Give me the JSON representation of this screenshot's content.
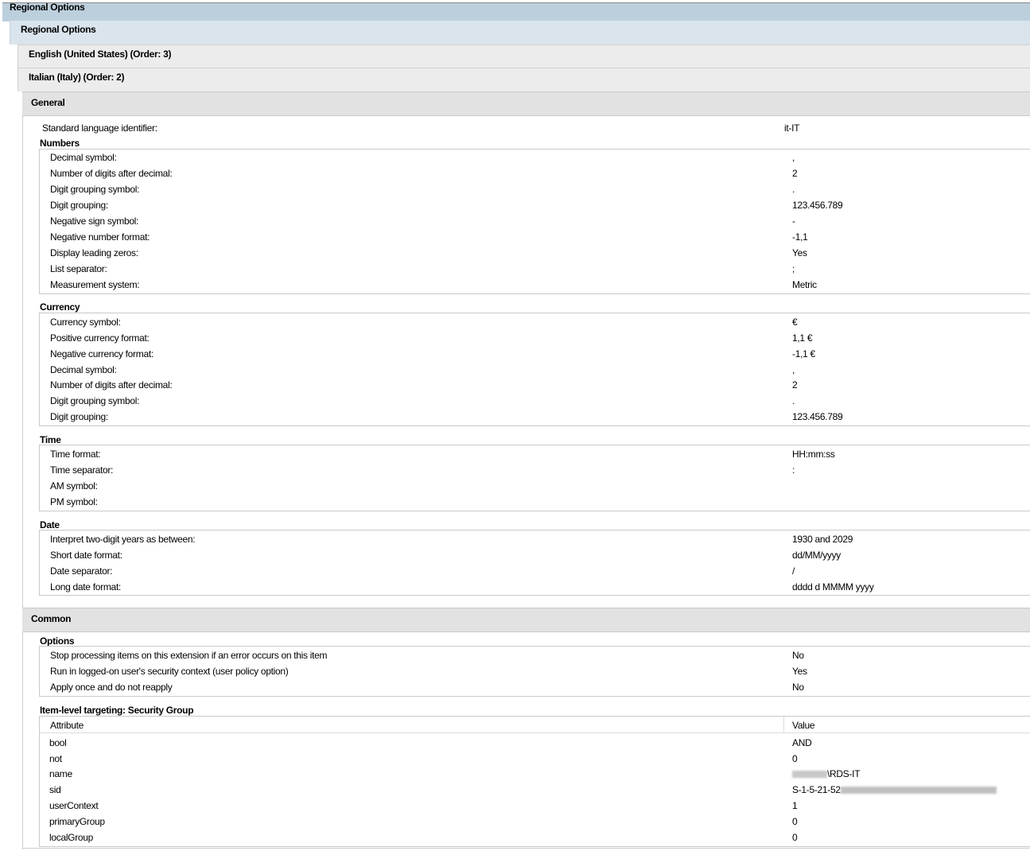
{
  "headers": {
    "root": "Regional Options",
    "sub": "Regional Options",
    "en": "English (United States) (Order: 3)",
    "it": "Italian (Italy) (Order: 2)",
    "general": "General",
    "common": "Common"
  },
  "std_lang": {
    "label": "Standard language identifier:",
    "value": "it-IT"
  },
  "numbers": {
    "title": "Numbers",
    "rows": [
      {
        "label": "Decimal symbol:",
        "value": ","
      },
      {
        "label": "Number of digits after decimal:",
        "value": "2"
      },
      {
        "label": "Digit grouping symbol:",
        "value": "."
      },
      {
        "label": "Digit grouping:",
        "value": "123.456.789"
      },
      {
        "label": "Negative sign symbol:",
        "value": "-"
      },
      {
        "label": "Negative number format:",
        "value": "-1,1"
      },
      {
        "label": "Display leading zeros:",
        "value": "Yes"
      },
      {
        "label": "List separator:",
        "value": ";"
      },
      {
        "label": "Measurement system:",
        "value": "Metric"
      }
    ]
  },
  "currency": {
    "title": "Currency",
    "rows": [
      {
        "label": "Currency symbol:",
        "value": "€"
      },
      {
        "label": "Positive currency format:",
        "value": "1,1 €"
      },
      {
        "label": "Negative currency format:",
        "value": "-1,1 €"
      },
      {
        "label": "Decimal symbol:",
        "value": ","
      },
      {
        "label": "Number of digits after decimal:",
        "value": "2"
      },
      {
        "label": "Digit grouping symbol:",
        "value": "."
      },
      {
        "label": "Digit grouping:",
        "value": "123.456.789"
      }
    ]
  },
  "time": {
    "title": "Time",
    "rows": [
      {
        "label": "Time format:",
        "value": "HH:mm:ss"
      },
      {
        "label": "Time separator:",
        "value": ":"
      },
      {
        "label": "AM symbol:",
        "value": ""
      },
      {
        "label": "PM symbol:",
        "value": ""
      }
    ]
  },
  "date": {
    "title": "Date",
    "rows": [
      {
        "label": "Interpret two-digit years as between:",
        "value": "1930 and 2029"
      },
      {
        "label": "Short date format:",
        "value": "dd/MM/yyyy"
      },
      {
        "label": "Date separator:",
        "value": "/"
      },
      {
        "label": "Long date format:",
        "value": "dddd d MMMM yyyy"
      }
    ]
  },
  "options": {
    "title": "Options",
    "rows": [
      {
        "label": "Stop processing items on this extension if an error occurs on this item",
        "value": "No"
      },
      {
        "label": "Run in logged-on user's security context (user policy option)",
        "value": "Yes"
      },
      {
        "label": "Apply once and do not reapply",
        "value": "No"
      }
    ]
  },
  "ilt": {
    "title": "Item-level targeting: Security Group",
    "col_attr": "Attribute",
    "col_value": "Value",
    "rows": [
      {
        "label": "bool",
        "value": "AND"
      },
      {
        "label": "not",
        "value": "0"
      },
      {
        "label": "name",
        "value": "\\RDS-IT"
      },
      {
        "label": "sid",
        "value": "S-1-5-21-52"
      },
      {
        "label": "userContext",
        "value": "1"
      },
      {
        "label": "primaryGroup",
        "value": "0"
      },
      {
        "label": "localGroup",
        "value": "0"
      }
    ]
  }
}
